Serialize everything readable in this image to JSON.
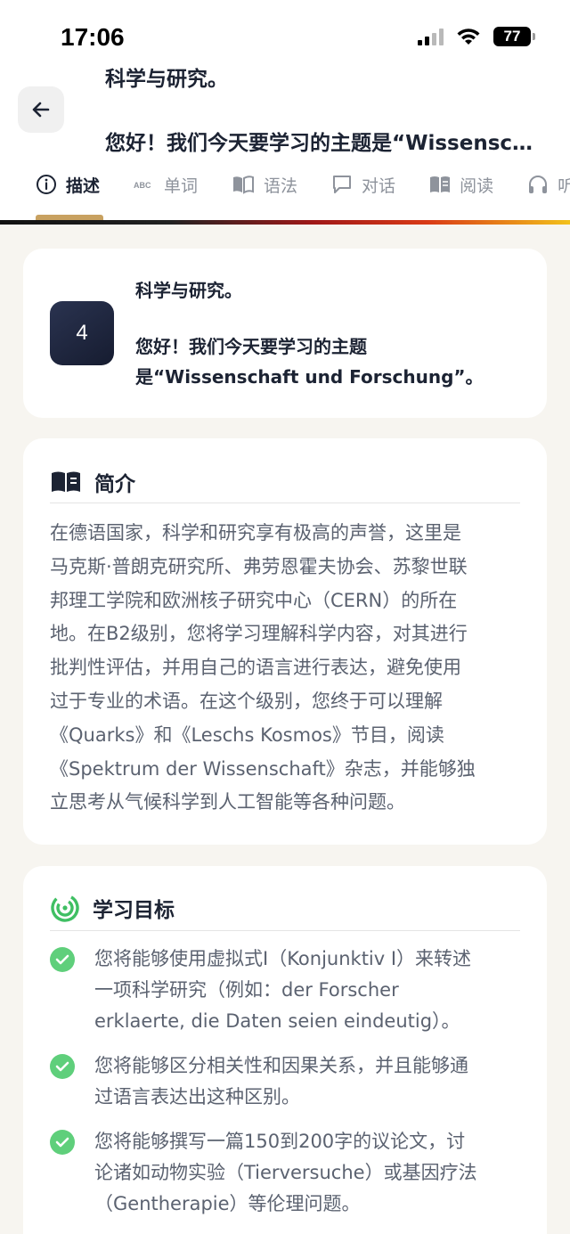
{
  "status_bar": {
    "time": "17:06",
    "battery": "77"
  },
  "header": {
    "title_line1": "科学与研究。",
    "title_line2": "您好！我们今天要学习的主题是“Wissenschaft und Forschung”。"
  },
  "tabs": [
    {
      "label": "描述",
      "icon": "info-icon",
      "active": true
    },
    {
      "label": "单词",
      "icon": "abc-icon",
      "active": false
    },
    {
      "label": "语法",
      "icon": "book-open-icon",
      "active": false
    },
    {
      "label": "对话",
      "icon": "chat-bubble-icon",
      "active": false
    },
    {
      "label": "阅读",
      "icon": "reading-icon",
      "active": false
    },
    {
      "label": "听力",
      "icon": "headphones-icon",
      "active": false
    }
  ],
  "unit": {
    "number": "4",
    "title": "科学与研究。",
    "greeting_line1": "您好！我们今天要学习的主题",
    "greeting_line2": "是“Wissenschaft und Forschung”。"
  },
  "intro": {
    "heading": "简介",
    "lines": [
      "在德语国家，科学和研究享有极高的声誉，这里是",
      "马克斯·普朗克研究所、弗劳恩霍夫协会、苏黎世联",
      "邦理工学院和欧洲核子研究中心（CERN）的所在",
      "地。在B2级别，您将学习理解科学内容，对其进行",
      "批判性评估，并用自己的语言进行表达，避免使用",
      "过于专业的术语。在这个级别，您终于可以理解",
      "《Quarks》和《Leschs Kosmos》节目，阅读",
      "《Spektrum der Wissenschaft》杂志，并能够独",
      "立思考从气候科学到人工智能等各种问题。"
    ]
  },
  "goals": {
    "heading": "学习目标",
    "items": [
      {
        "lines": [
          "您将能够使用虚拟式I（Konjunktiv I）来转述",
          "一项科学研究（例如：der Forscher",
          "erklaerte, die Daten seien eindeutig）。"
        ]
      },
      {
        "lines": [
          "您将能够区分相关性和因果关系，并且能够通",
          "过语言表达出这种区别。"
        ]
      },
      {
        "lines": [
          "您将能够撰写一篇150到200字的议论文，讨",
          "论诸如动物实验（Tierversuche）或基因疗法",
          "（Gentherapie）等伦理问题。"
        ]
      }
    ]
  },
  "colors": {
    "accent": "#c8a160",
    "check": "#5fcf7b",
    "goal_icon": "#3fbf63",
    "badge": "#1f2740"
  }
}
